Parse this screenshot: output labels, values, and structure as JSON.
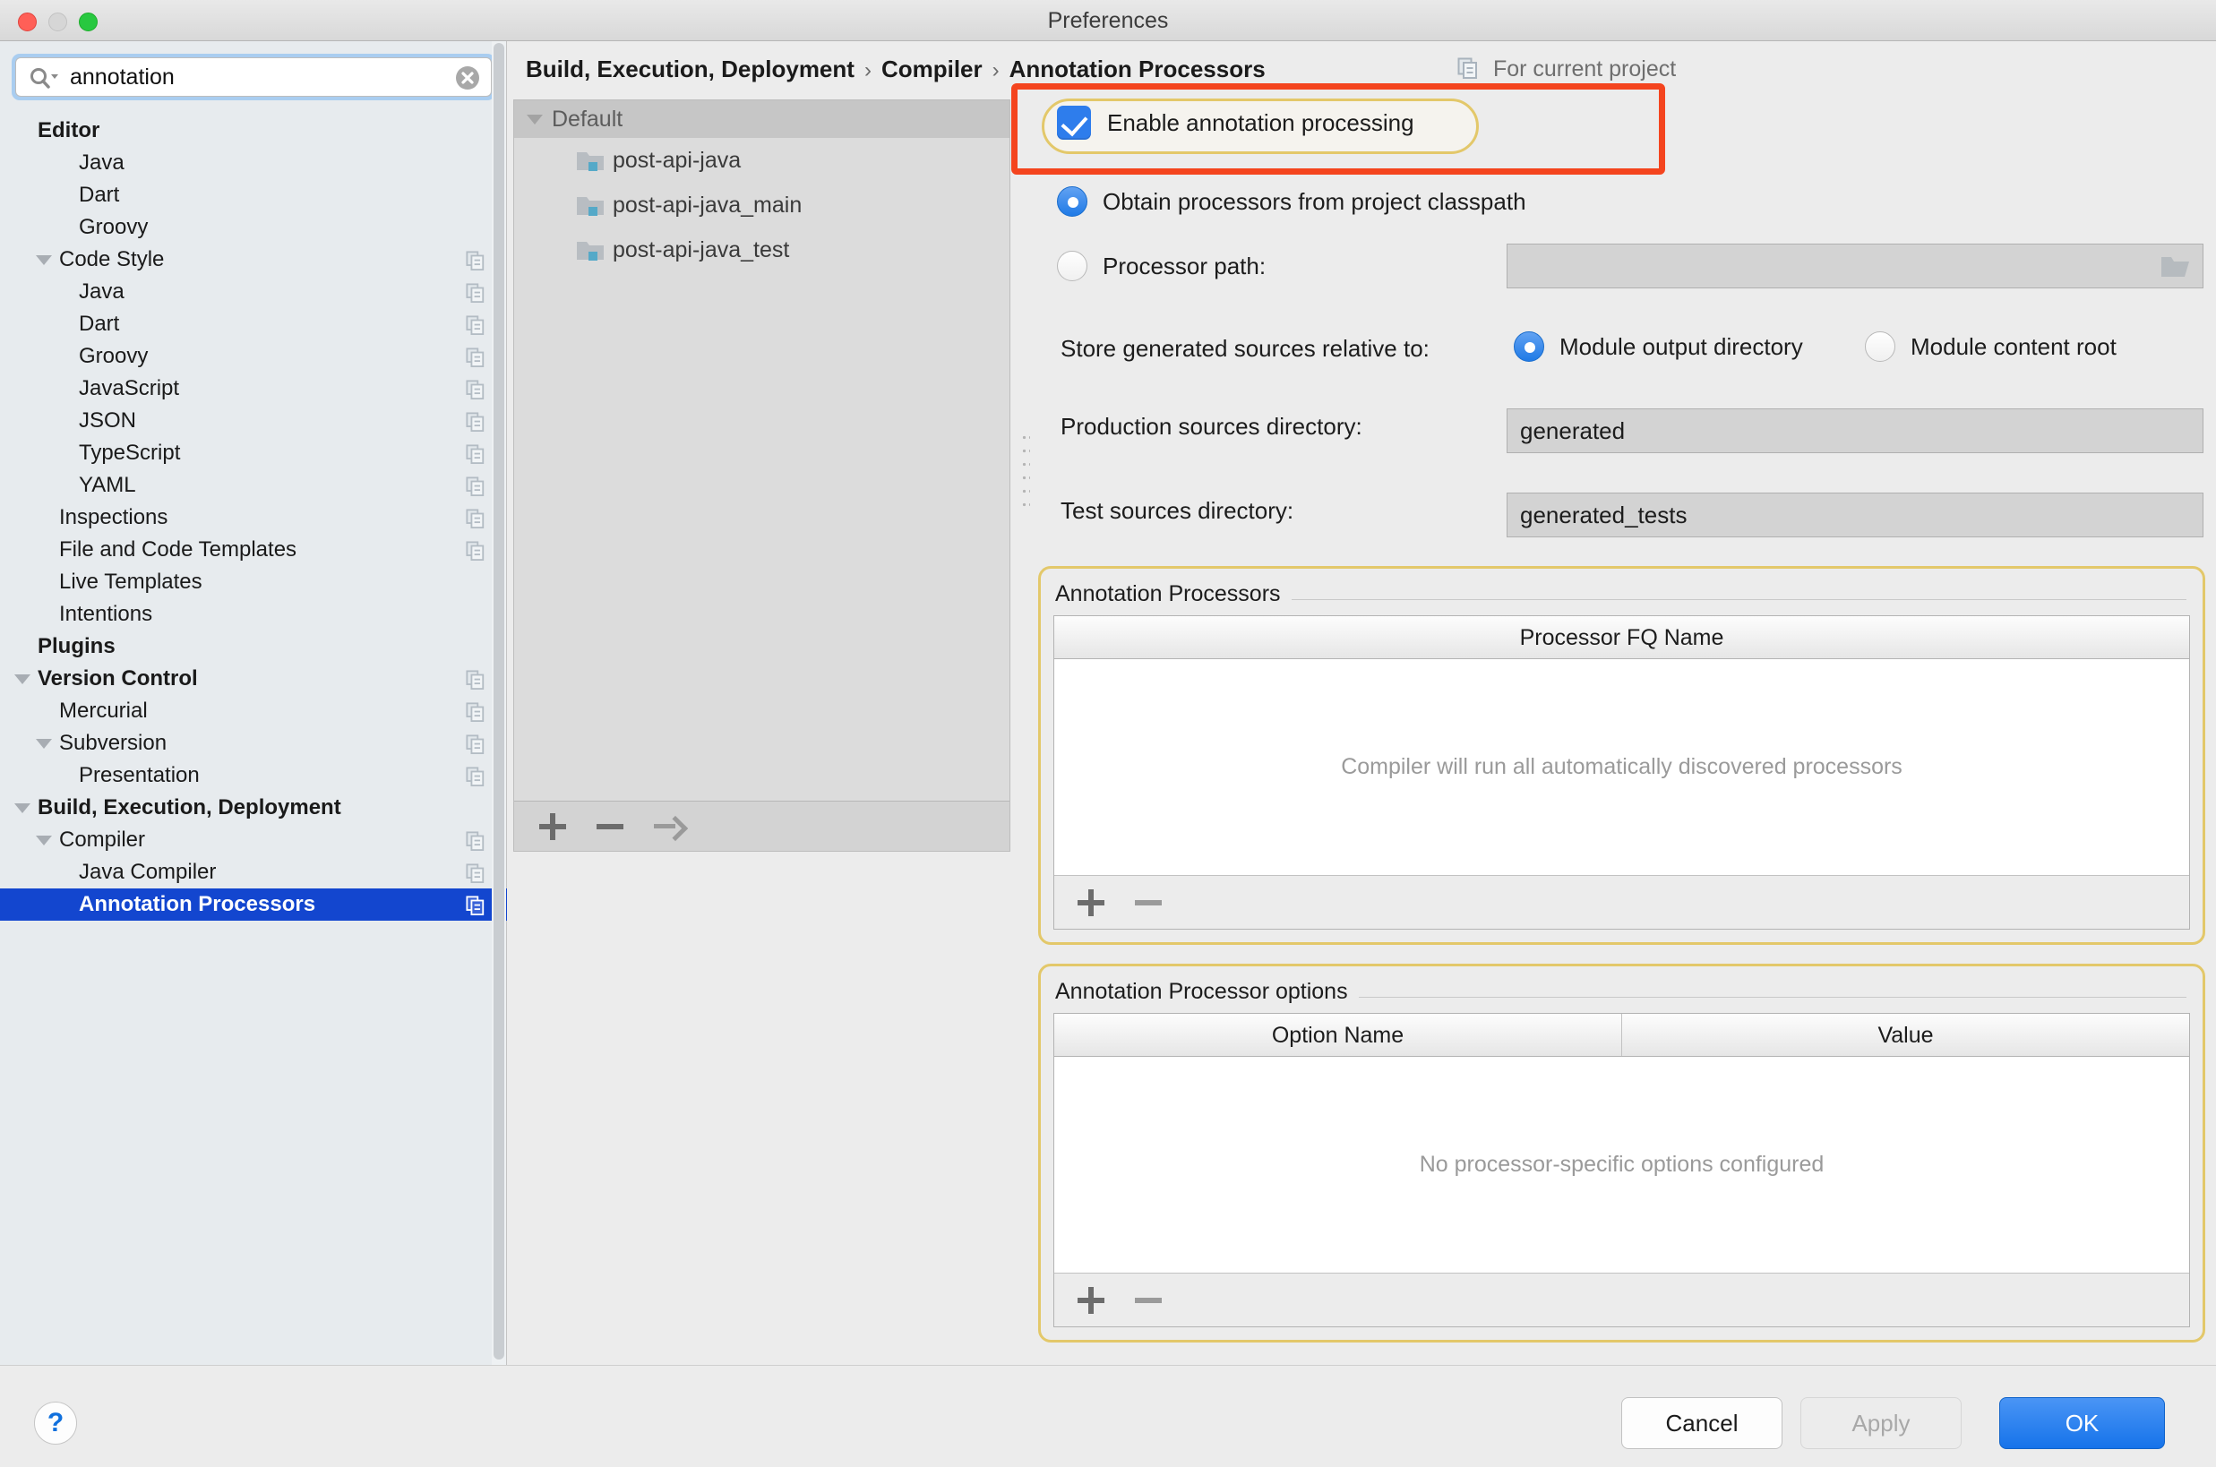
{
  "window": {
    "title": "Preferences"
  },
  "search": {
    "value": "annotation",
    "placeholder": ""
  },
  "sidebar": {
    "items": [
      {
        "label": "Editor",
        "indent": 42,
        "bold": true,
        "arrow": false,
        "copy": false,
        "selected": false
      },
      {
        "label": "Java",
        "indent": 88,
        "bold": false,
        "arrow": false,
        "copy": false,
        "selected": false
      },
      {
        "label": "Dart",
        "indent": 88,
        "bold": false,
        "arrow": false,
        "copy": false,
        "selected": false
      },
      {
        "label": "Groovy",
        "indent": 88,
        "bold": false,
        "arrow": false,
        "copy": false,
        "selected": false
      },
      {
        "label": "Code Style",
        "indent": 66,
        "bold": false,
        "arrow": true,
        "arrowX": 40,
        "copy": true,
        "selected": false
      },
      {
        "label": "Java",
        "indent": 88,
        "bold": false,
        "arrow": false,
        "copy": true,
        "selected": false
      },
      {
        "label": "Dart",
        "indent": 88,
        "bold": false,
        "arrow": false,
        "copy": true,
        "selected": false
      },
      {
        "label": "Groovy",
        "indent": 88,
        "bold": false,
        "arrow": false,
        "copy": true,
        "selected": false
      },
      {
        "label": "JavaScript",
        "indent": 88,
        "bold": false,
        "arrow": false,
        "copy": true,
        "selected": false
      },
      {
        "label": "JSON",
        "indent": 88,
        "bold": false,
        "arrow": false,
        "copy": true,
        "selected": false
      },
      {
        "label": "TypeScript",
        "indent": 88,
        "bold": false,
        "arrow": false,
        "copy": true,
        "selected": false
      },
      {
        "label": "YAML",
        "indent": 88,
        "bold": false,
        "arrow": false,
        "copy": true,
        "selected": false
      },
      {
        "label": "Inspections",
        "indent": 66,
        "bold": false,
        "arrow": false,
        "copy": true,
        "selected": false
      },
      {
        "label": "File and Code Templates",
        "indent": 66,
        "bold": false,
        "arrow": false,
        "copy": true,
        "selected": false
      },
      {
        "label": "Live Templates",
        "indent": 66,
        "bold": false,
        "arrow": false,
        "copy": false,
        "selected": false
      },
      {
        "label": "Intentions",
        "indent": 66,
        "bold": false,
        "arrow": false,
        "copy": false,
        "selected": false
      },
      {
        "label": "Plugins",
        "indent": 42,
        "bold": true,
        "arrow": false,
        "copy": false,
        "selected": false
      },
      {
        "label": "Version Control",
        "indent": 42,
        "bold": true,
        "arrow": true,
        "arrowX": 16,
        "copy": true,
        "selected": false
      },
      {
        "label": "Mercurial",
        "indent": 66,
        "bold": false,
        "arrow": false,
        "copy": true,
        "selected": false
      },
      {
        "label": "Subversion",
        "indent": 66,
        "bold": false,
        "arrow": true,
        "arrowX": 40,
        "copy": true,
        "selected": false
      },
      {
        "label": "Presentation",
        "indent": 88,
        "bold": false,
        "arrow": false,
        "copy": true,
        "selected": false
      },
      {
        "label": "Build, Execution, Deployment",
        "indent": 42,
        "bold": true,
        "arrow": true,
        "arrowX": 16,
        "copy": false,
        "selected": false
      },
      {
        "label": "Compiler",
        "indent": 66,
        "bold": false,
        "arrow": true,
        "arrowX": 40,
        "copy": true,
        "selected": false
      },
      {
        "label": "Java Compiler",
        "indent": 88,
        "bold": false,
        "arrow": false,
        "copy": true,
        "selected": false
      },
      {
        "label": "Annotation Processors",
        "indent": 88,
        "bold": true,
        "arrow": false,
        "copy": true,
        "selected": true
      }
    ]
  },
  "breadcrumb": {
    "parts": [
      "Build, Execution, Deployment",
      "Compiler",
      "Annotation Processors"
    ],
    "separator": "›"
  },
  "for_project": {
    "label": "For current project"
  },
  "module_tree": {
    "root": "Default",
    "modules": [
      "post-api-java",
      "post-api-java_main",
      "post-api-java_test"
    ],
    "toolbar": {
      "add": "+",
      "remove": "−",
      "move": "→"
    }
  },
  "options": {
    "enable_annotation_processing": {
      "label": "Enable annotation processing",
      "checked": true
    },
    "obtain_from_classpath": {
      "label": "Obtain processors from project classpath",
      "selected": true
    },
    "processor_path": {
      "label": "Processor path:",
      "selected": false,
      "value": "",
      "browse_icon": "folder-icon"
    },
    "store_relative_to": {
      "label": "Store generated sources relative to:",
      "choices": [
        "Module output directory",
        "Module content root"
      ],
      "selected_index": 0
    },
    "production_sources": {
      "label": "Production sources directory:",
      "value": "generated"
    },
    "test_sources": {
      "label": "Test sources directory:",
      "value": "generated_tests"
    }
  },
  "processors_group": {
    "title": "Annotation Processors",
    "columns": [
      "Processor FQ Name"
    ],
    "rows": [],
    "empty_message": "Compiler will run all automatically discovered processors",
    "toolbar": {
      "add": "+",
      "remove": "−"
    }
  },
  "processor_options_group": {
    "title": "Annotation Processor options",
    "columns": [
      "Option Name",
      "Value"
    ],
    "rows": [],
    "empty_message": "No processor-specific options configured",
    "toolbar": {
      "add": "+",
      "remove": "−"
    }
  },
  "footer": {
    "help": "?",
    "cancel": "Cancel",
    "apply": "Apply",
    "ok": "OK"
  },
  "colors": {
    "selection_blue": "#1346cf",
    "accent_blue": "#2e7dec",
    "highlight_red": "#f4441e",
    "highlight_yellow": "#e3c86a"
  }
}
